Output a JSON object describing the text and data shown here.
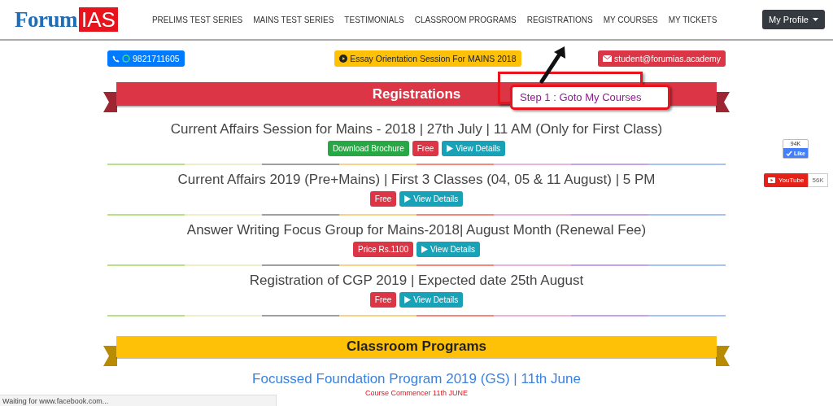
{
  "header": {
    "logo": {
      "text": "Forum",
      "badge": "IAS"
    },
    "nav": [
      {
        "label": "PRELIMS TEST SERIES"
      },
      {
        "label": "MAINS TEST SERIES"
      },
      {
        "label": "TESTIMONIALS"
      },
      {
        "label": "CLASSROOM PROGRAMS"
      },
      {
        "label": "REGISTRATIONS"
      },
      {
        "label": "MY COURSES"
      },
      {
        "label": "MY TICKETS"
      }
    ],
    "profile_button": "My Profile"
  },
  "contact_bar": [
    {
      "kind": "phone",
      "label": "9821711605"
    },
    {
      "kind": "event",
      "label": "Essay Orientation Session For MAINS 2018"
    },
    {
      "kind": "email",
      "label": "student@forumias.academy"
    }
  ],
  "sections": [
    {
      "title": "Registrations",
      "color": "#dc3545",
      "items": [
        {
          "kind": "heading",
          "title": "Current Affairs Session for Mains - 2018 | 27th July | 11 AM (Only for First Class)",
          "buttons": [
            {
              "kind": "download",
              "label": "Download Brochure"
            },
            {
              "kind": "price",
              "label": "Free"
            },
            {
              "kind": "details",
              "label": "View Details"
            }
          ]
        },
        {
          "kind": "heading",
          "title": "Current Affairs 2019 (Pre+Mains) | First 3 Classes (04, 05 & 11 August) | 5 PM",
          "buttons": [
            {
              "kind": "price",
              "label": "Free"
            },
            {
              "kind": "details",
              "label": "View Details"
            }
          ]
        },
        {
          "kind": "heading",
          "title": "Answer Writing Focus Group for Mains-2018| August Month (Renewal Fee)",
          "buttons": [
            {
              "kind": "price",
              "label": "Price Rs.1100"
            },
            {
              "kind": "details",
              "label": "View Details"
            }
          ]
        },
        {
          "kind": "heading",
          "title": "Registration of CGP 2019 | Expected date 25th August",
          "buttons": [
            {
              "kind": "price",
              "label": "Free"
            },
            {
              "kind": "details",
              "label": "View Details"
            }
          ]
        }
      ]
    },
    {
      "title": "Classroom Programs",
      "color": "#ffc107",
      "items": [
        {
          "kind": "link",
          "title": "Focussed Foundation Program 2019 (GS) | 11th June",
          "note": "Course Commencer 11th JUNE"
        }
      ]
    }
  ],
  "annotation": {
    "text": "Step 1 : Goto My Courses"
  },
  "social": {
    "facebook": {
      "count": "94K",
      "label": "Like"
    },
    "youtube": {
      "label": "YouTube",
      "count": "56K"
    }
  },
  "status_bar": "Waiting for www.facebook.com..."
}
